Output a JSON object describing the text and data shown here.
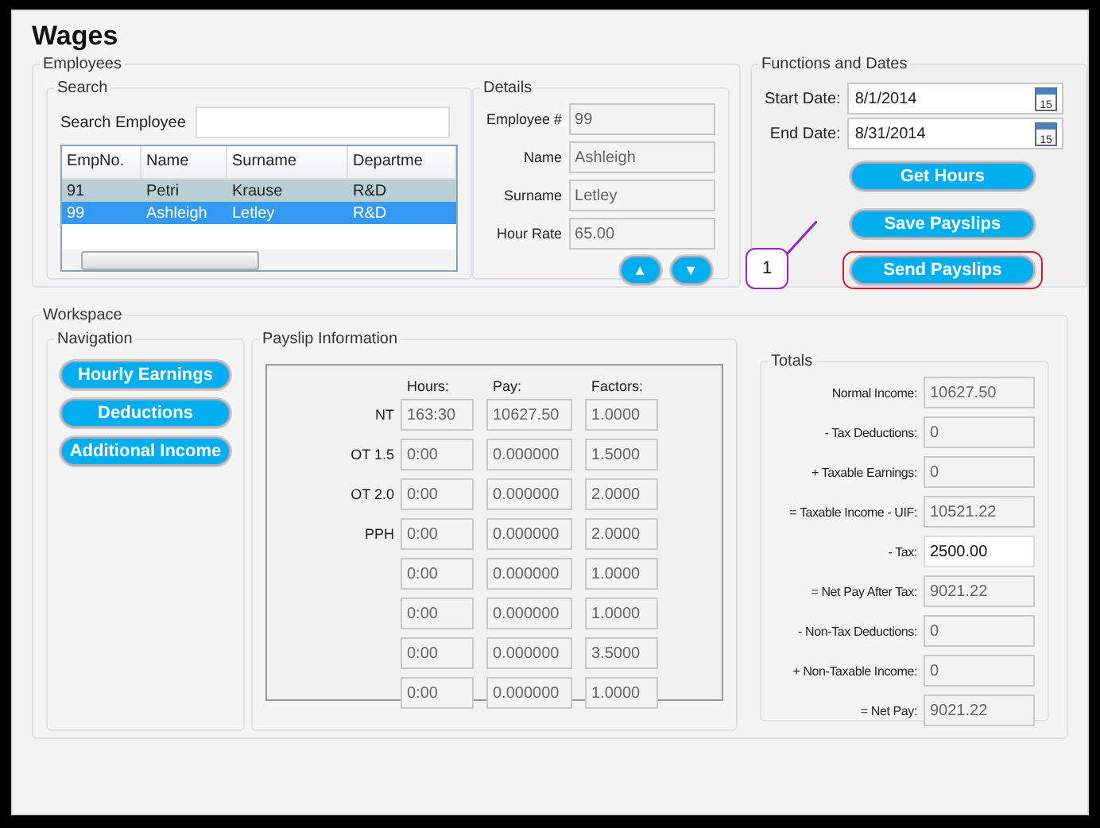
{
  "title": "Wages",
  "employees": {
    "title": "Employees",
    "search": {
      "title": "Search",
      "label": "Search Employee",
      "columns": [
        "EmpNo.",
        "Name",
        "Surname",
        "Departme"
      ],
      "rows": [
        {
          "cells": [
            "91",
            "Petri",
            "Krause",
            "R&D"
          ],
          "selected": false
        },
        {
          "cells": [
            "99",
            "Ashleigh",
            "Letley",
            "R&D"
          ],
          "selected": true
        }
      ]
    },
    "details": {
      "title": "Details",
      "fields": [
        {
          "label": "Employee #",
          "value": "99"
        },
        {
          "label": "Name",
          "value": "Ashleigh"
        },
        {
          "label": "Surname",
          "value": "Letley"
        },
        {
          "label": "Hour Rate",
          "value": "65.00"
        }
      ],
      "nav_buttons": [
        "▲",
        "▼"
      ]
    }
  },
  "functions": {
    "title": "Functions and Dates",
    "dates": [
      {
        "label": "Start Date:",
        "value": "8/1/2014",
        "calendar_day": "15"
      },
      {
        "label": "End Date:",
        "value": "8/31/2014",
        "calendar_day": "15"
      }
    ],
    "buttons": [
      {
        "label": "Get Hours",
        "highlighted": false
      },
      {
        "label": "Save Payslips",
        "highlighted": false
      },
      {
        "label": "Send Payslips",
        "highlighted": true
      }
    ],
    "callout": "1"
  },
  "workspace": {
    "title": "Workspace",
    "navigation": {
      "title": "Navigation",
      "buttons": [
        "Hourly Earnings",
        "Deductions",
        "Additional Income"
      ]
    },
    "payslip": {
      "title": "Payslip Information",
      "headers": [
        "Hours:",
        "Pay:",
        "Factors:"
      ],
      "rows": [
        {
          "label": "NT",
          "hours": "163:30",
          "pay": "10627.50",
          "factor": "1.0000"
        },
        {
          "label": "OT 1.5",
          "hours": "0:00",
          "pay": "0.000000",
          "factor": "1.5000"
        },
        {
          "label": "OT 2.0",
          "hours": "0:00",
          "pay": "0.000000",
          "factor": "2.0000"
        },
        {
          "label": "PPH",
          "hours": "0:00",
          "pay": "0.000000",
          "factor": "2.0000"
        },
        {
          "hours": "0:00",
          "pay": "0.000000",
          "factor": "1.0000"
        },
        {
          "hours": "0:00",
          "pay": "0.000000",
          "factor": "1.0000"
        },
        {
          "hours": "0:00",
          "pay": "0.000000",
          "factor": "3.5000"
        },
        {
          "hours": "0:00",
          "pay": "0.000000",
          "factor": "1.0000"
        }
      ]
    },
    "totals": {
      "title": "Totals",
      "rows": [
        {
          "label": "Normal Income:",
          "value": "10627.50",
          "editable": false
        },
        {
          "label": "- Tax Deductions:",
          "value": "0",
          "editable": false
        },
        {
          "label": "+ Taxable Earnings:",
          "value": "0",
          "editable": false
        },
        {
          "label": "= Taxable Income - UIF:",
          "value": "10521.22",
          "editable": false
        },
        {
          "label": "- Tax:",
          "value": "2500.00",
          "editable": true
        },
        {
          "label": "= Net Pay After Tax:",
          "value": "9021.22",
          "editable": false
        },
        {
          "label": "- Non-Tax Deductions:",
          "value": "0",
          "editable": false
        },
        {
          "label": "+ Non-Taxable Income:",
          "value": "0",
          "editable": false
        },
        {
          "label": "= Net Pay:",
          "value": "9021.22",
          "editable": false
        }
      ]
    }
  }
}
